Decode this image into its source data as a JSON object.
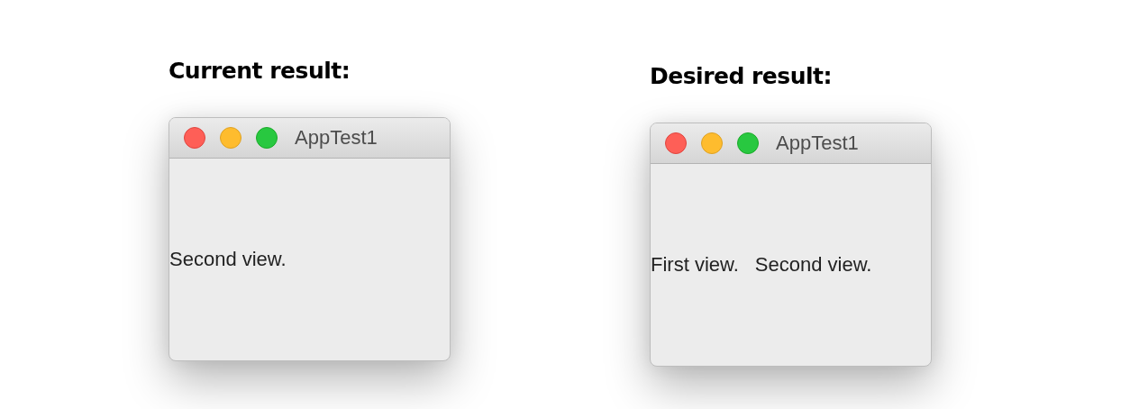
{
  "panels": [
    {
      "heading": "Current result:",
      "window": {
        "title": "AppTest1",
        "views": [
          "Second view."
        ]
      }
    },
    {
      "heading": "Desired result:",
      "window": {
        "title": "AppTest1",
        "views": [
          "First view.",
          "Second view."
        ]
      }
    }
  ]
}
